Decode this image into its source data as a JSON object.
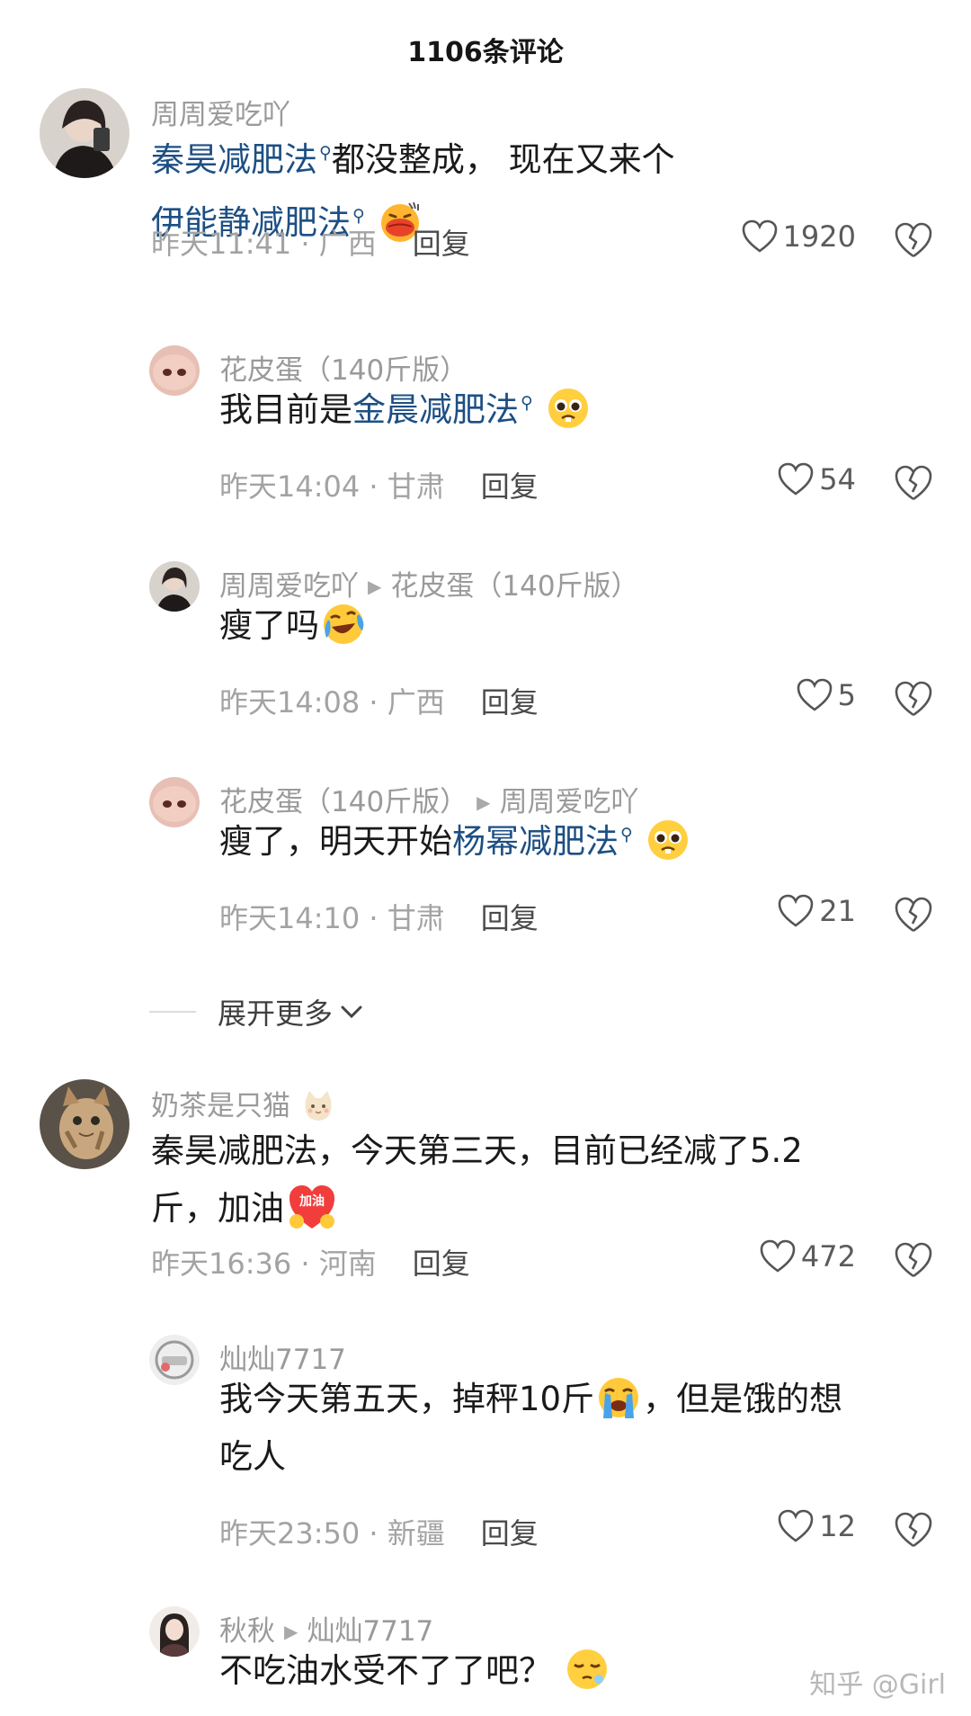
{
  "header": {
    "title": "1106条评论"
  },
  "comments": [
    {
      "name": "周周爱吃吖",
      "body_parts": [
        "秦昊减肥法",
        "都没整成， 现在又来个",
        "伊能静减肥法"
      ],
      "time": "昨天11:41 · 广西",
      "reply_label": "回复",
      "likes": "1920",
      "emoji": "pout-kiss-emoji"
    },
    {
      "name": "花皮蛋（140斤版）",
      "body_parts": [
        "我目前是",
        "金晨减肥法"
      ],
      "time": "昨天14:04 · 甘肃",
      "reply_label": "回复",
      "likes": "54",
      "emoji": "pleading-face-emoji"
    },
    {
      "name": "周周爱吃吖",
      "reply_to": "花皮蛋（140斤版）",
      "body_parts": [
        "瘦了吗"
      ],
      "time": "昨天14:08 · 广西",
      "reply_label": "回复",
      "likes": "5",
      "emoji": "laugh-cry-emoji"
    },
    {
      "name": "花皮蛋（140斤版）",
      "reply_to": "周周爱吃吖",
      "body_parts": [
        "瘦了，明天开始",
        "杨幂减肥法"
      ],
      "time": "昨天14:10 · 甘肃",
      "reply_label": "回复",
      "likes": "21",
      "emoji": "pleading-face-emoji"
    },
    {
      "name": "奶茶是只猫",
      "body_parts": [
        "秦昊减肥法，今天第三天，目前已经减了5.2",
        "斤，加油"
      ],
      "sticker_text": "加油",
      "time": "昨天16:36 · 河南",
      "reply_label": "回复",
      "likes": "472",
      "emoji": "cat-face-emoji"
    },
    {
      "name": "灿灿7717",
      "body_parts": [
        "我今天第五天，掉秤10斤",
        "，但是饿的想",
        "吃人"
      ],
      "time": "昨天23:50 · 新疆",
      "reply_label": "回复",
      "likes": "12",
      "emoji": "crying-face-emoji"
    },
    {
      "name": "秋秋",
      "reply_to": "灿灿7717",
      "body_parts": [
        "不吃油水受不了了吧？"
      ],
      "emoji": "sleepy-face-emoji"
    }
  ],
  "expand": {
    "label": "展开更多"
  },
  "watermark": "知乎 @Girl",
  "colors": {
    "link": "#1d4f84",
    "meta": "#a3a3a3",
    "name": "#9a9a9a"
  }
}
